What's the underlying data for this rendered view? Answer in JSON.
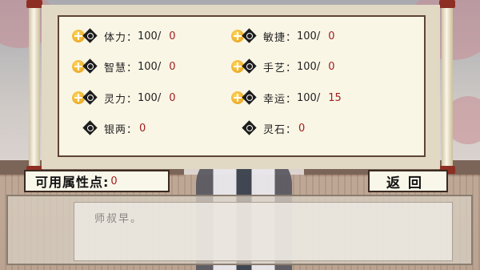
{
  "stats": [
    {
      "label": "体力：",
      "value": "100/",
      "added": "0"
    },
    {
      "label": "敏捷：",
      "value": "100/",
      "added": "0"
    },
    {
      "label": "智慧：",
      "value": "100/",
      "added": "0"
    },
    {
      "label": "手艺：",
      "value": "100/",
      "added": "0"
    },
    {
      "label": "灵力：",
      "value": "100/",
      "added": "0"
    },
    {
      "label": "幸运：",
      "value": "100/",
      "added": "15"
    }
  ],
  "currency": [
    {
      "label": "银两：",
      "value": "0"
    },
    {
      "label": "灵石：",
      "value": "0"
    }
  ],
  "points": {
    "label": "可用属性点:",
    "value": "0"
  },
  "return_label": "返回",
  "dialog": {
    "text": "师叔早。"
  },
  "colors": {
    "value_red": "#a31d1d",
    "frame_brown": "#5d4433",
    "paper": "#faf6e6"
  },
  "icons": [
    "plus-icon",
    "diamond-icon"
  ]
}
